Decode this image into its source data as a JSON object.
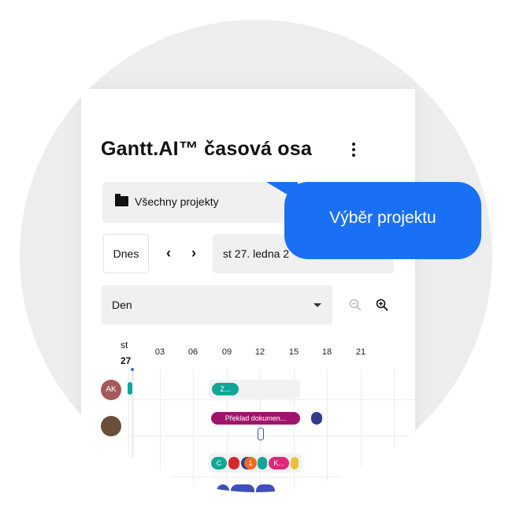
{
  "header": {
    "title": "Gantt.AI™ časová osa"
  },
  "project_selector": {
    "label": "Všechny projekty",
    "icon": "folder-icon"
  },
  "nav": {
    "today_label": "Dnes",
    "prev_icon": "chevron-left-icon",
    "next_icon": "chevron-right-icon",
    "date_value": "st 27. ledna 2"
  },
  "view": {
    "selected": "Den",
    "zoom_out_icon": "zoom-out-icon",
    "zoom_in_icon": "zoom-in-icon"
  },
  "timeline": {
    "day_name": "st",
    "day_number": "27",
    "hours": [
      "03",
      "06",
      "09",
      "12",
      "15",
      "18",
      "21"
    ]
  },
  "rows": [
    {
      "avatar_initials": "AK",
      "avatar_color": "#a45a5a",
      "tasks": [
        "Z..."
      ]
    },
    {
      "avatar_initials": "",
      "avatar_color": "#6b4f3a",
      "tasks": [
        "Překlad dokumen..."
      ]
    },
    {
      "avatar_initials": "",
      "avatar_color": "",
      "tasks": [
        "C",
        "1",
        "K..."
      ]
    }
  ],
  "callout": {
    "text": "Výběr projektu",
    "color": "#1a70f5"
  },
  "colors": {
    "teal": "#11a697",
    "magenta": "#a0156b",
    "navy": "#2f3b8c",
    "red": "#d62828",
    "orange": "#f06a1f",
    "pink": "#e0267a",
    "yellow": "#e9c23a",
    "indigo": "#3d4fb8"
  }
}
